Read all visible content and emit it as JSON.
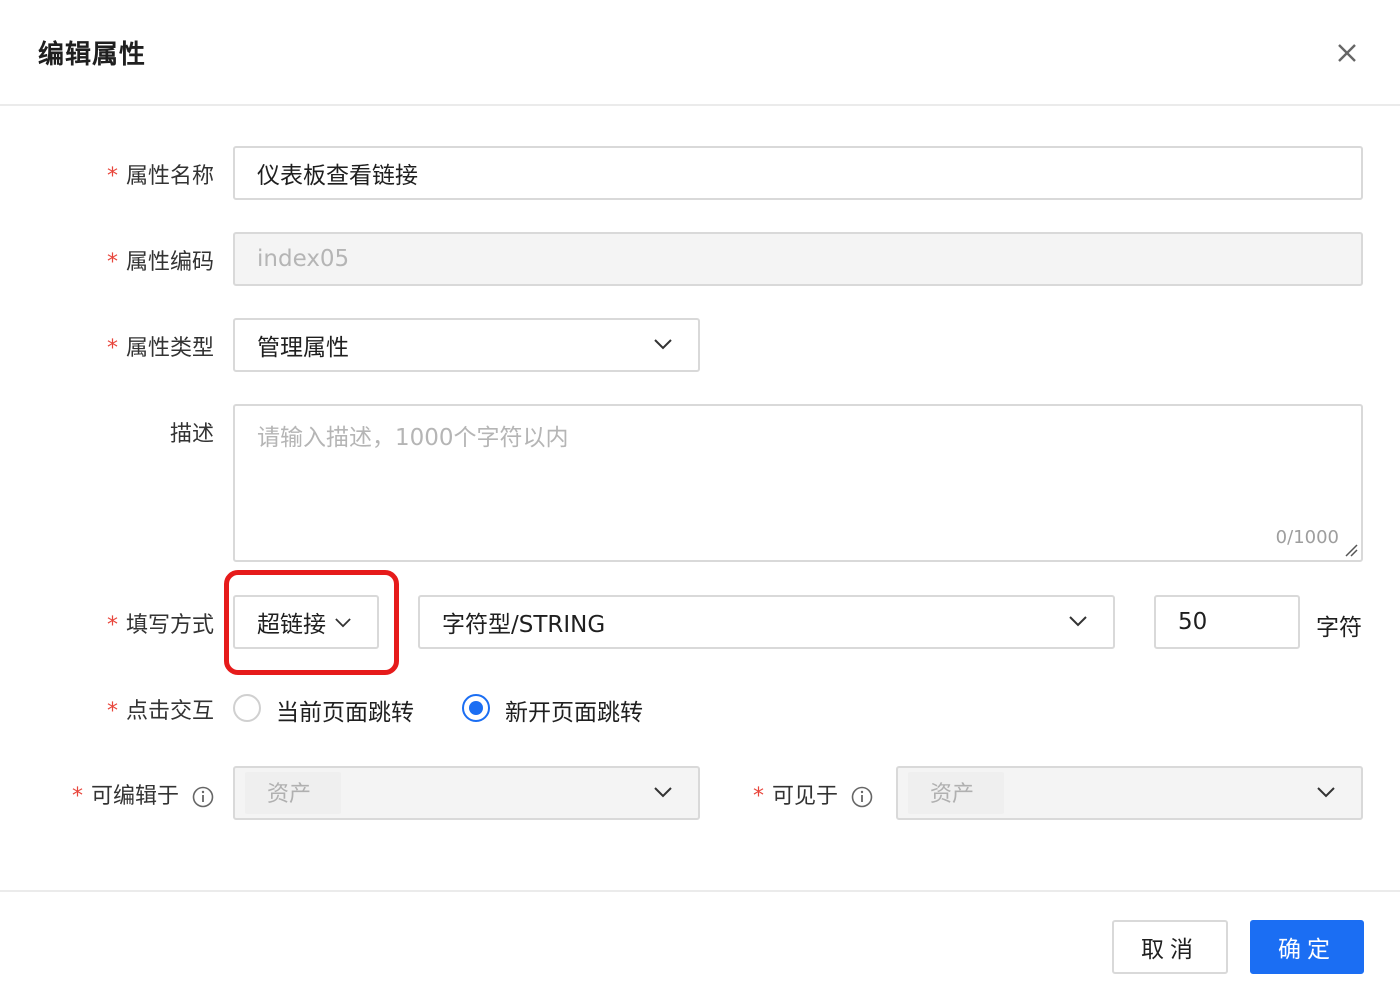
{
  "dialog": {
    "title": "编辑属性",
    "close_icon": "close-icon"
  },
  "form": {
    "required_mark": "*",
    "name": {
      "label": "属性名称",
      "value": "仪表板查看链接"
    },
    "code": {
      "label": "属性编码",
      "value": "index05"
    },
    "type": {
      "label": "属性类型",
      "value": "管理属性"
    },
    "description": {
      "label": "描述",
      "placeholder": "请输入描述，1000个字符以内",
      "counter": "0/1000"
    },
    "fill_mode": {
      "label": "填写方式",
      "mode_value": "超链接",
      "data_type_value": "字符型/STRING",
      "length_value": "50",
      "length_unit": "字符"
    },
    "click_interaction": {
      "label": "点击交互",
      "options": [
        {
          "label": "当前页面跳转",
          "checked": false
        },
        {
          "label": "新开页面跳转",
          "checked": true
        }
      ]
    },
    "editable_by": {
      "label": "可编辑于",
      "tag": "资产"
    },
    "visible_to": {
      "label": "可见于",
      "tag": "资产"
    }
  },
  "footer": {
    "cancel_label": "取消",
    "ok_label": "确定"
  },
  "colors": {
    "primary": "#1b6ef3",
    "required": "#e8463c",
    "highlight": "#e61b1b"
  }
}
